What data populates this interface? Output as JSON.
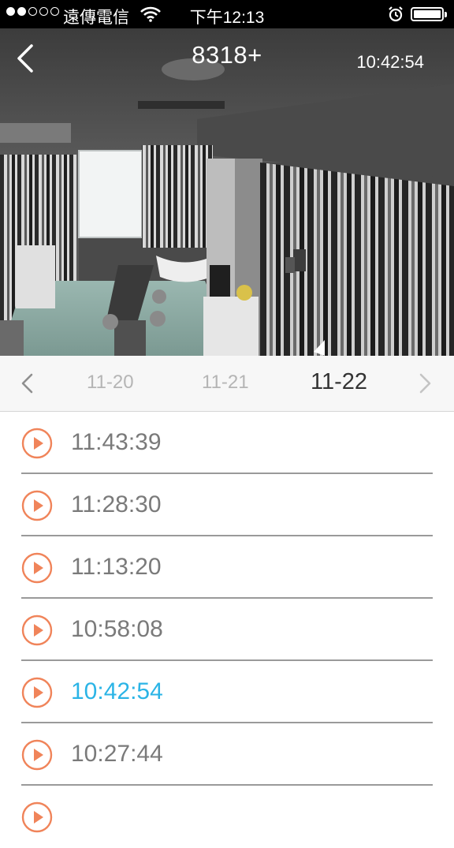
{
  "status_bar": {
    "carrier": "遠傳電信",
    "time": "下午12:13"
  },
  "camera": {
    "title": "8318+",
    "timestamp": "10:42:54"
  },
  "date_selector": {
    "dates": [
      "11-20",
      "11-21",
      "11-22"
    ],
    "selected": "11-22"
  },
  "recordings": [
    {
      "time": "11:43:39"
    },
    {
      "time": "11:28:30"
    },
    {
      "time": "11:13:20"
    },
    {
      "time": "10:58:08"
    },
    {
      "time": "10:42:54"
    },
    {
      "time": "10:27:44"
    }
  ],
  "colors": {
    "accent_play": "#f0845a",
    "active_time": "#2bb4e6"
  },
  "icons": {
    "back": "chevron-left-icon",
    "prev_date": "chevron-left-icon",
    "next_date": "chevron-right-icon",
    "play": "play-circle-icon"
  }
}
